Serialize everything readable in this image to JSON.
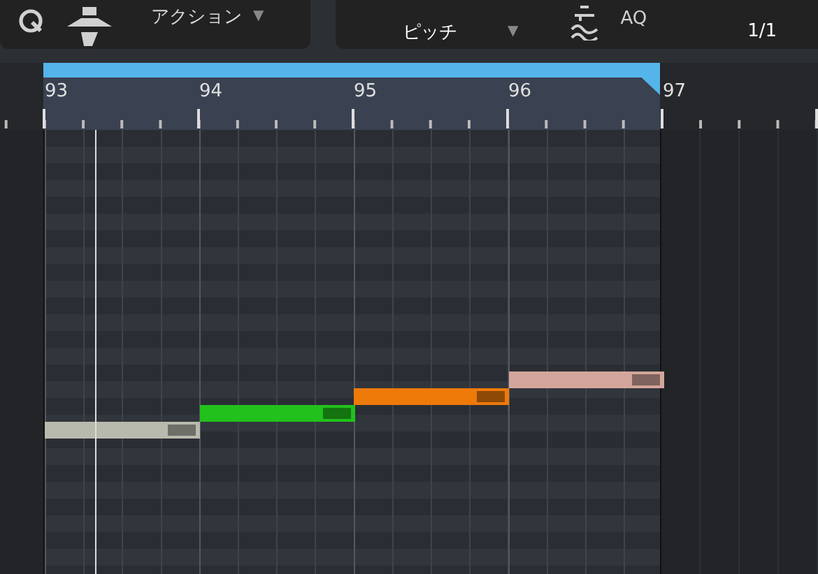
{
  "toolbar": {
    "action_menu": {
      "label": "アクション",
      "caret": "▼"
    },
    "note_color_menu": {
      "value": "ピッチ",
      "caret": "▼"
    },
    "aq_label": "AQ",
    "quantize_value": "1/1"
  },
  "ruler": {
    "bars": [
      "93",
      "94",
      "95",
      "96",
      "97"
    ]
  },
  "notes": [
    {
      "color": "#b8baad"
    },
    {
      "color": "#22c11c"
    },
    {
      "color": "#ee7a0a"
    },
    {
      "color": "#d4a69b"
    }
  ]
}
